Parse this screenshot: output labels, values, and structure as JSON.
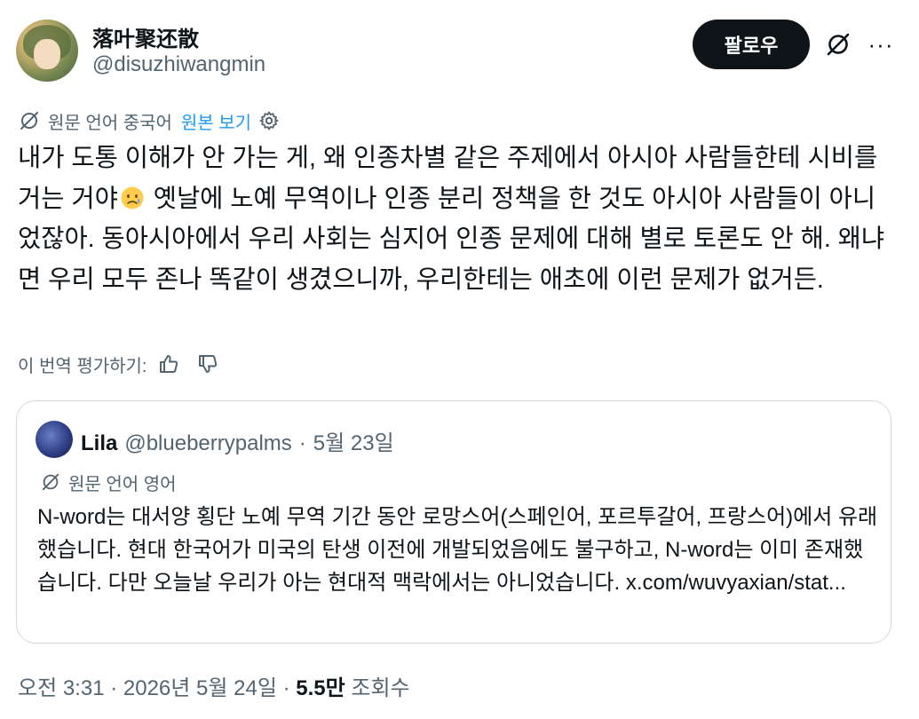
{
  "author": {
    "display_name": "落叶聚还散",
    "handle": "@disuzhiwangmin"
  },
  "actions": {
    "follow_label": "팔로우",
    "grok_icon": "grok-icon",
    "more_icon": "more-icon",
    "more_label": "···"
  },
  "translation": {
    "source_label": "원문 언어 중국어",
    "show_original_label": "원본 보기"
  },
  "tweet": {
    "text_part1": "내가 도통 이해가 안 가는 게, 왜 인종차별 같은 주제에서 아시아 사람들한테 시비를 거는 거야",
    "emoji": "sad-sweat-face-emoji",
    "text_part2": " 옛날에 노예 무역이나 인종 분리 정책을 한 것도 아시아 사람들이 아니었잖아. 동아시아에서 우리 사회는 심지어 인종 문제에 대해 별로 토론도 안 해. 왜냐면 우리 모두 존나 똑같이 생겼으니까, 우리한테는 애초에 이런 문제가 없거든."
  },
  "rate_translation": {
    "label": "이 번역 평가하기:"
  },
  "quoted": {
    "name": "Lila",
    "handle": "@blueberrypalms",
    "separator": "·",
    "date": "5월 23일",
    "translation_label": "원문 언어 영어",
    "text": "N-word는 대서양 횡단 노예 무역 기간 동안 로망스어(스페인어, 포르투갈어, 프랑스어)에서 유래했습니다. 현대 한국어가 미국의 탄생 이전에 개발되었음에도 불구하고, N-word는 이미 존재했습니다. 다만 오늘날 우리가 아는 현대적 맥락에서는 아니었습니다. x.com/wuvyaxian/stat..."
  },
  "meta": {
    "time": "오전 3:31",
    "sep1": "·",
    "date": "2026년 5월 24일",
    "sep2": "·",
    "views_count": "5.5만",
    "views_label": "조회수"
  },
  "colors": {
    "text_primary": "#0f1419",
    "text_secondary": "#536471",
    "link": "#1d9bf0",
    "border": "#cfd9de",
    "follow_bg": "#0f1419"
  }
}
